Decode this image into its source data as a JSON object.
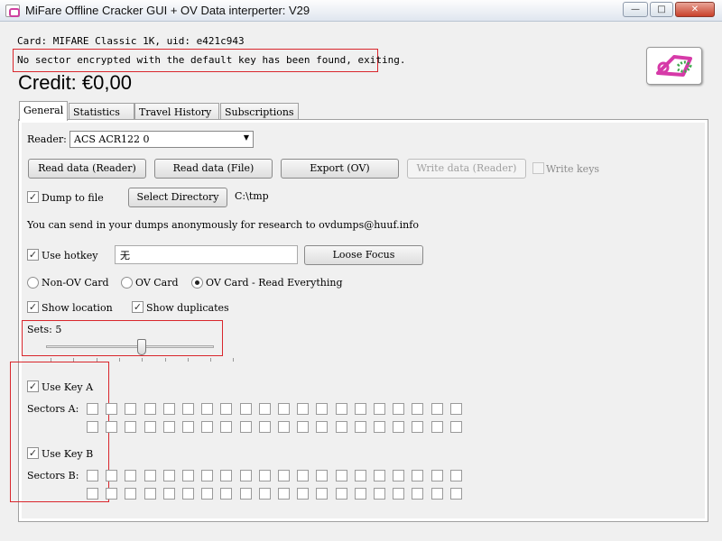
{
  "window": {
    "title": "MiFare Offline Cracker GUI + OV Data interperter: V29",
    "min": "—",
    "max": "□",
    "close": "✕"
  },
  "header": {
    "card_info": "Card: MIFARE Classic 1K, uid: e421c943",
    "status": "No sector encrypted with the default key has been found, exiting.",
    "credit": "Credit: €0,00"
  },
  "tabs": [
    "General",
    "Statistics",
    "Travel History",
    "Subscriptions"
  ],
  "general": {
    "reader_label": "Reader:",
    "reader_value": "ACS ACR122 0",
    "buttons": {
      "read_reader": "Read data (Reader)",
      "read_file": "Read data (File)",
      "export": "Export (OV)",
      "write_reader": "Write data (Reader)"
    },
    "write_keys_label": "Write keys",
    "dump_to_file_label": "Dump to file",
    "select_directory": "Select Directory",
    "directory_path": "C:\\tmp",
    "research_text": "You can send in your dumps anonymously for research to ovdumps@huuf.info",
    "use_hotkey_label": "Use hotkey",
    "hotkey_value": "无",
    "loose_focus": "Loose Focus",
    "radios": {
      "non_ov": "Non-OV Card",
      "ov": "OV Card",
      "ov_read_all": "OV Card - Read Everything"
    },
    "show_location": "Show location",
    "show_duplicates": "Show duplicates",
    "sets_label": "Sets: 5",
    "sets_value": 5,
    "use_key_a": "Use Key A",
    "sectors_a": "Sectors A:",
    "use_key_b": "Use Key B",
    "sectors_b": "Sectors B:"
  },
  "colors": {
    "annotation": "#d9262c",
    "window_bg": "#f0f0f0"
  }
}
